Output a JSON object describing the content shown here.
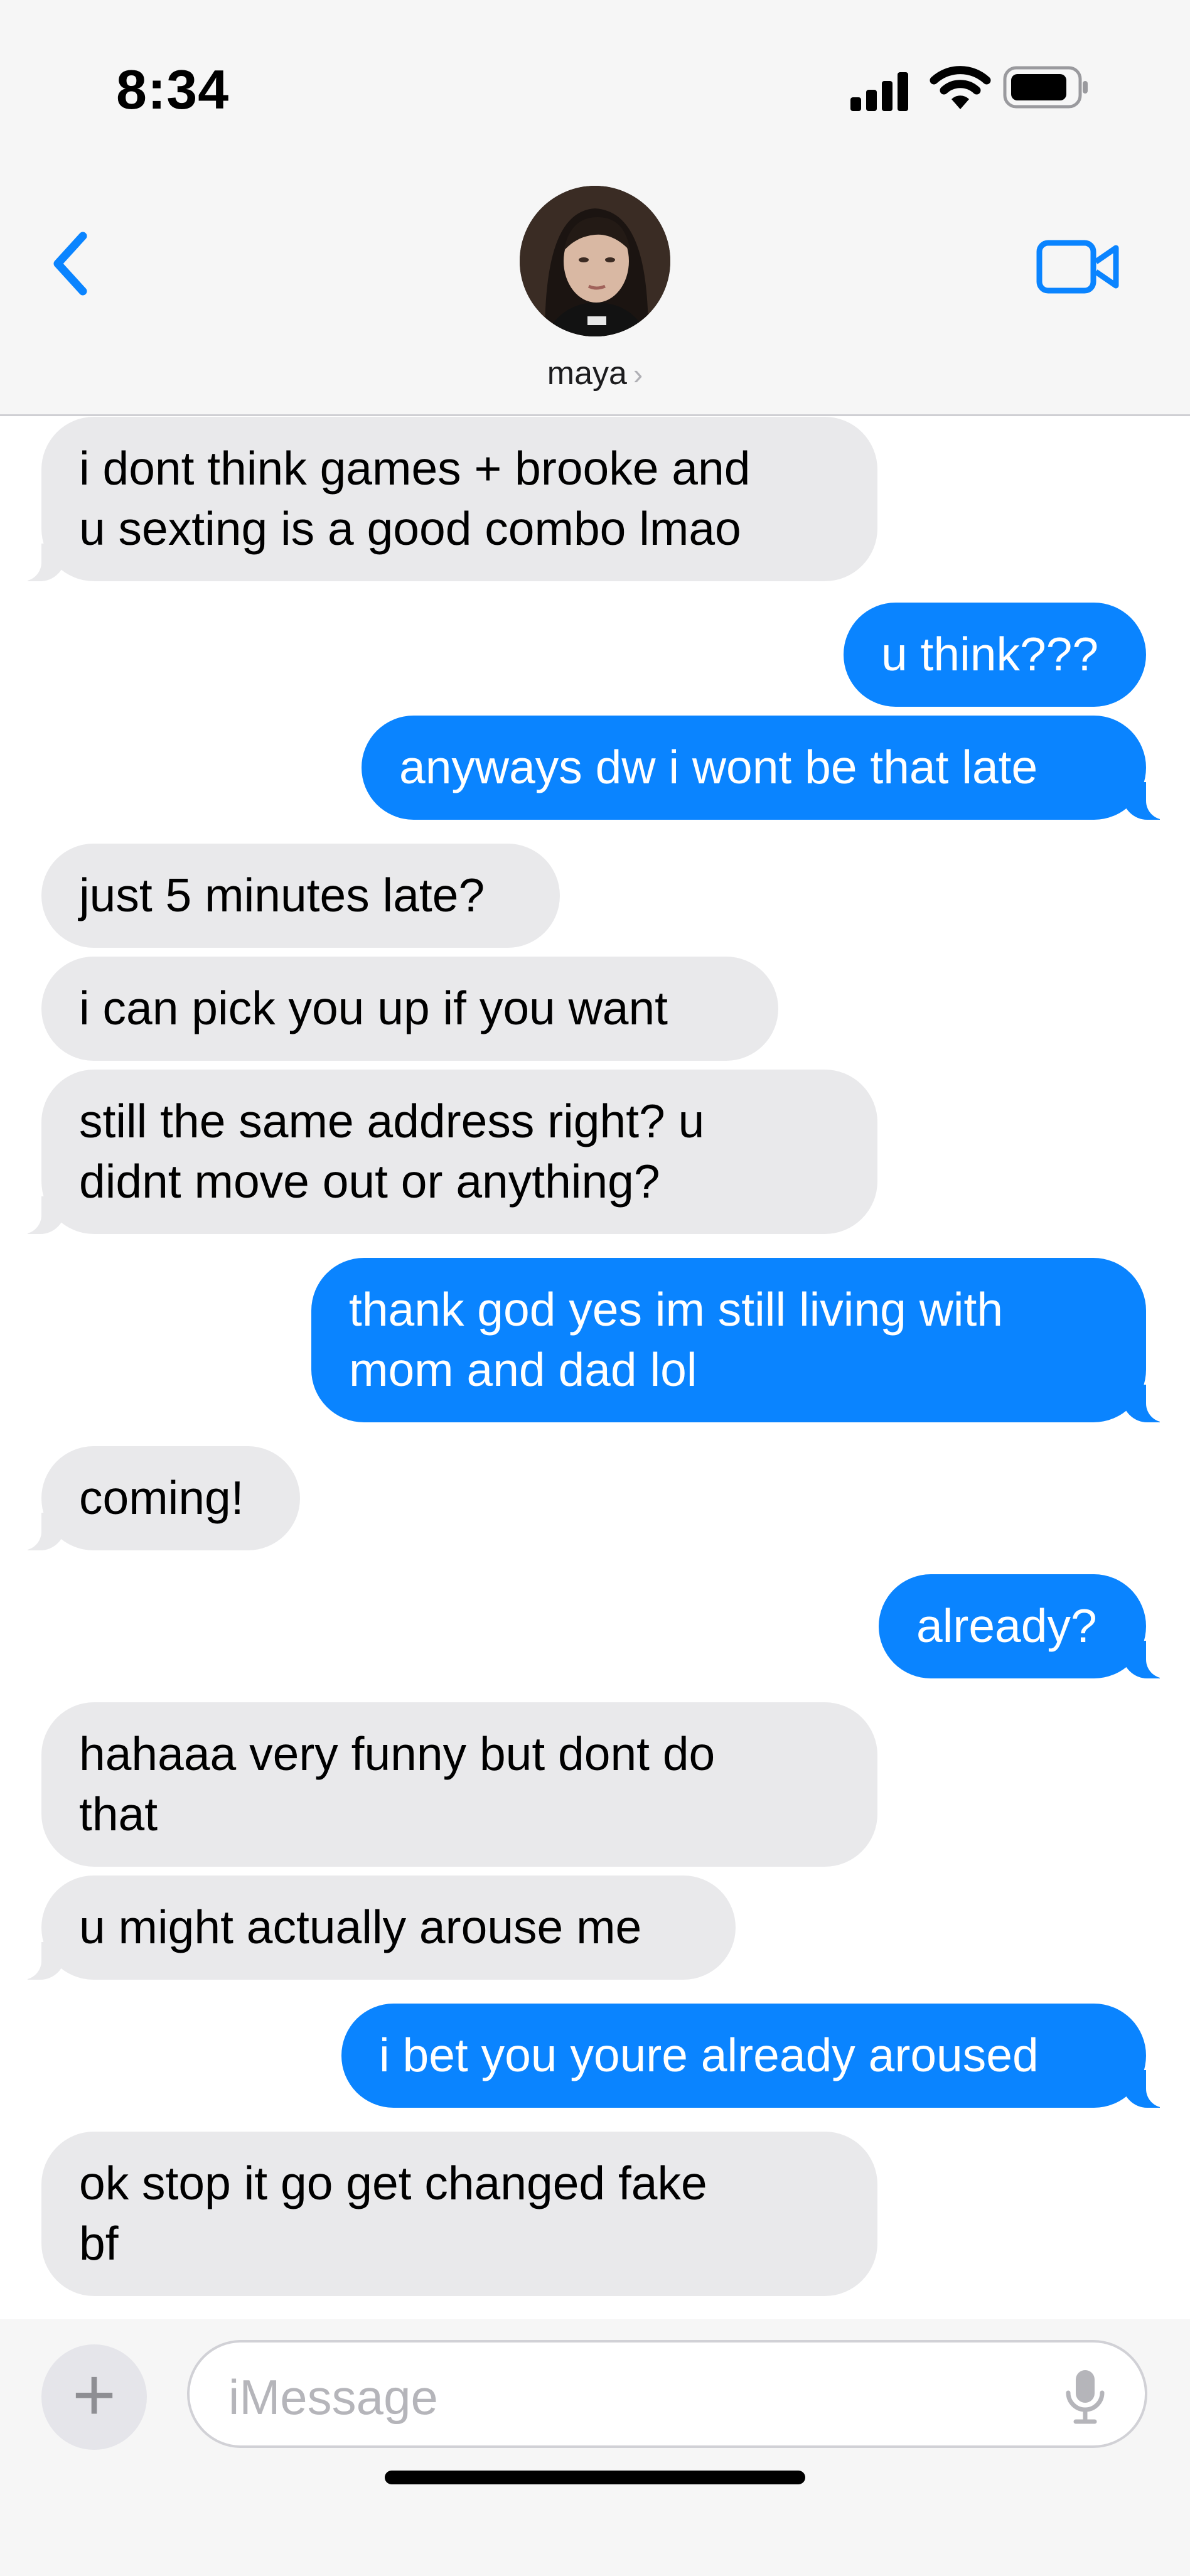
{
  "status_bar": {
    "time": "8:34"
  },
  "header": {
    "contact_name": "maya",
    "chevron": "›"
  },
  "messages": [
    {
      "from": "them",
      "lines": [
        "i dont think games + brooke and",
        "u sexting is a good combo lmao"
      ]
    },
    {
      "from": "me",
      "lines": [
        "u think???"
      ]
    },
    {
      "from": "me",
      "lines": [
        "anyways dw i wont be that late"
      ]
    },
    {
      "from": "them",
      "lines": [
        "just 5 minutes late?"
      ]
    },
    {
      "from": "them",
      "lines": [
        "i can pick you up if you want"
      ]
    },
    {
      "from": "them",
      "lines": [
        "still the same address right? u",
        "didnt move out or anything?"
      ]
    },
    {
      "from": "me",
      "lines": [
        "thank god yes im still living with",
        "mom and dad lol"
      ]
    },
    {
      "from": "them",
      "lines": [
        "coming!"
      ]
    },
    {
      "from": "me",
      "lines": [
        "already?"
      ]
    },
    {
      "from": "them",
      "lines": [
        "hahaaa very funny but dont do",
        "that"
      ]
    },
    {
      "from": "them",
      "lines": [
        "u might actually arouse me"
      ]
    },
    {
      "from": "me",
      "lines": [
        "i bet you youre already aroused"
      ]
    },
    {
      "from": "them",
      "lines": [
        "ok stop it go get changed fake",
        "bf"
      ]
    }
  ],
  "composer": {
    "placeholder": "iMessage",
    "plus": "+"
  },
  "icons": {
    "back": "chevron-left-icon",
    "video": "video-camera-icon",
    "mic": "microphone-icon",
    "signal": "cellular-signal-icon",
    "wifi": "wifi-icon",
    "battery": "battery-icon"
  },
  "colors": {
    "accent": "#0a84ff",
    "incoming_bubble": "#e9e9eb",
    "header_bg": "#f6f6f6"
  }
}
